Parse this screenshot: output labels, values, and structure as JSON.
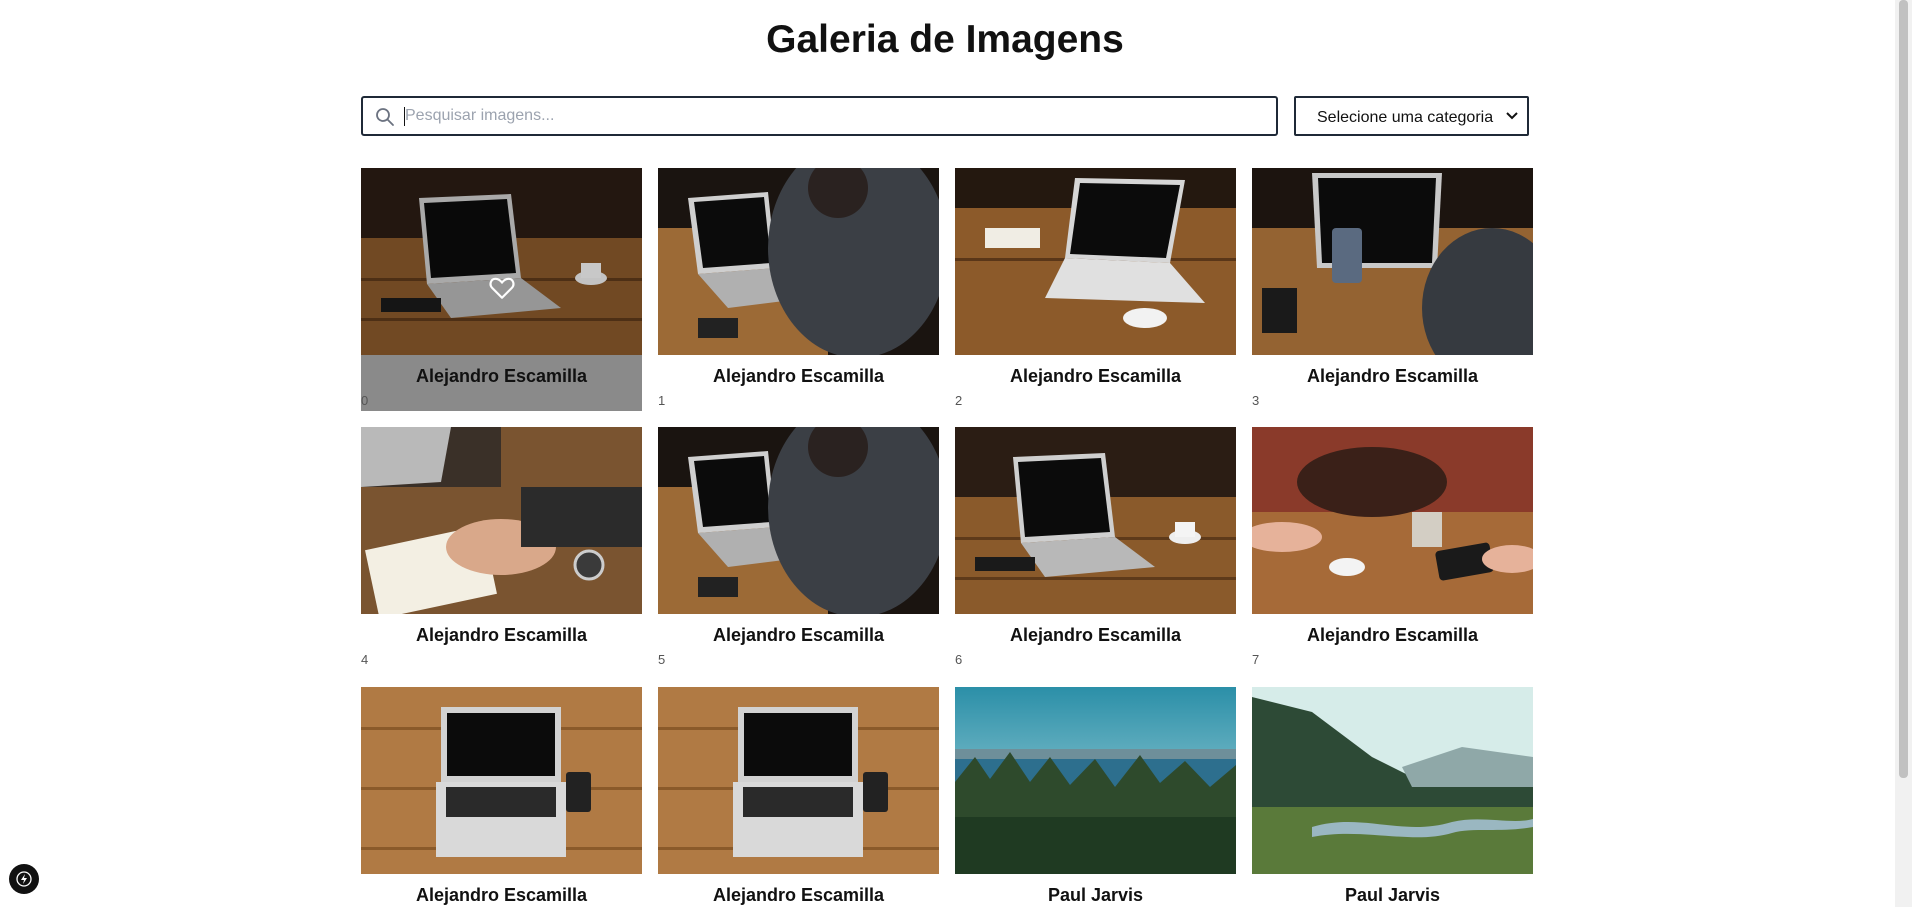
{
  "page": {
    "title": "Galeria de Imagens"
  },
  "search": {
    "placeholder": "Pesquisar imagens...",
    "value": "",
    "icon": "search-icon"
  },
  "category": {
    "selected": "Selecione uma categoria",
    "icon": "chevron-down-icon"
  },
  "gallery": {
    "items": [
      {
        "author": "Alejandro Escamilla",
        "index": "0",
        "scene": "laptop-table-dark",
        "hovered": true
      },
      {
        "author": "Alejandro Escamilla",
        "index": "1",
        "scene": "person-laptop"
      },
      {
        "author": "Alejandro Escamilla",
        "index": "2",
        "scene": "laptop-table-white"
      },
      {
        "author": "Alejandro Escamilla",
        "index": "3",
        "scene": "person-phone-laptop"
      },
      {
        "author": "Alejandro Escamilla",
        "index": "4",
        "scene": "writing-notebook"
      },
      {
        "author": "Alejandro Escamilla",
        "index": "5",
        "scene": "person-laptop"
      },
      {
        "author": "Alejandro Escamilla",
        "index": "6",
        "scene": "laptop-table-dark"
      },
      {
        "author": "Alejandro Escamilla",
        "index": "7",
        "scene": "brick-bag-table"
      },
      {
        "author": "Alejandro Escamilla",
        "index": "",
        "scene": "laptop-overhead"
      },
      {
        "author": "Alejandro Escamilla",
        "index": "",
        "scene": "laptop-overhead"
      },
      {
        "author": "Paul Jarvis",
        "index": "",
        "scene": "sea-forest"
      },
      {
        "author": "Paul Jarvis",
        "index": "",
        "scene": "valley-river"
      }
    ],
    "hover_icon": "heart-icon"
  },
  "colors": {
    "border": "#1f2937",
    "hover_caption": "#8a8a8a"
  }
}
